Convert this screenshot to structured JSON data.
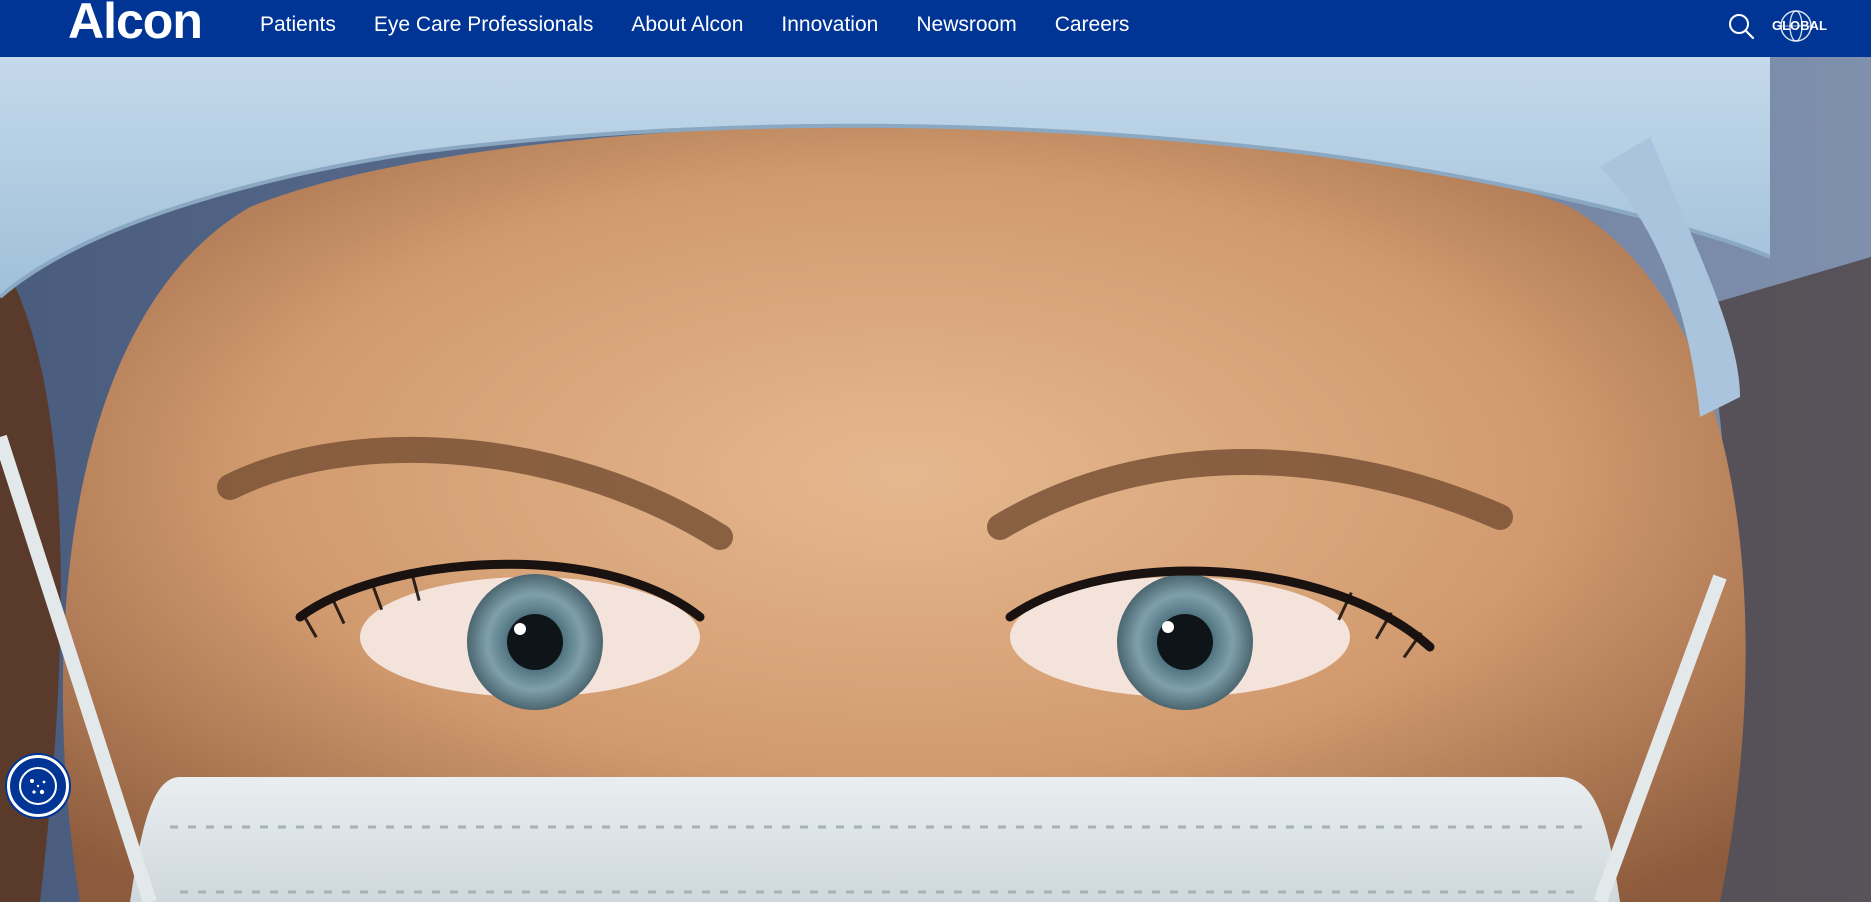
{
  "brand": {
    "logo_text": "Alcon",
    "primary_color": "#003595"
  },
  "nav": {
    "items": [
      {
        "label": "Patients"
      },
      {
        "label": "Eye Care Professionals"
      },
      {
        "label": "About Alcon"
      },
      {
        "label": "Innovation"
      },
      {
        "label": "Newsroom"
      },
      {
        "label": "Careers"
      }
    ],
    "search_icon": "search-icon",
    "global_label": "GLOBAL",
    "global_icon": "globe-icon"
  },
  "hero": {
    "image": "surgeon-eyes-with-surgical-cap-and-mask"
  },
  "cookie": {
    "icon": "cookie-icon"
  }
}
